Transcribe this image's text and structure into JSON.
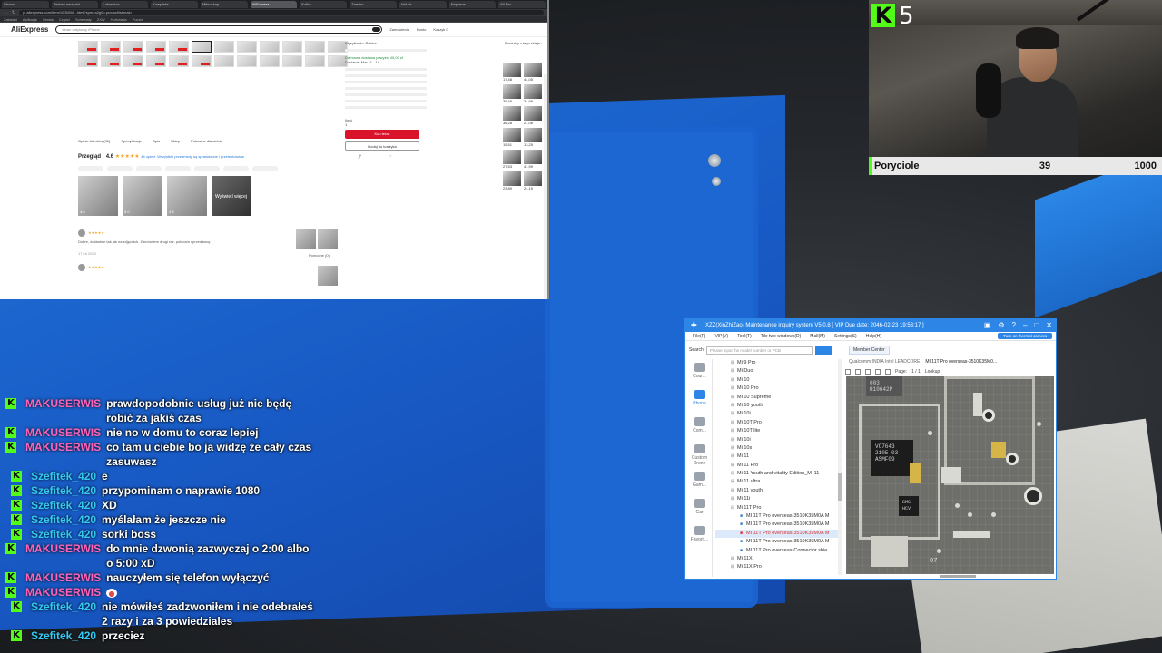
{
  "browser": {
    "tabs": [
      "Strona",
      "Zestaw narzędzi",
      "Lutownica",
      "Kompleks",
      "Mikroskop",
      "AliExpress",
      "Kolba",
      "Zamów",
      "Hot air",
      "Naprawa",
      "MI Pro"
    ],
    "address": "pl.aliexpress.com/item/1005006...html?spm=a2g0o.productlist.main",
    "bookmarks": [
      "Zakładki",
      "Aplikacje",
      "Serwis",
      "Części",
      "Schematy",
      "ZXW",
      "Hurtownia",
      "Poczta"
    ],
    "site_logo": "AliExpress",
    "search_placeholder": "ekran dotykowy iPhone",
    "header_right": [
      "Zamówienia",
      "Konto",
      "Koszyk 0"
    ],
    "detail_tabs": [
      "Opinie klientów (90)",
      "Specyfikacje",
      "Opis",
      "Sklep",
      "Polecane dla ciebie"
    ],
    "reviews_title": "Przegląd",
    "rating": "4.6",
    "stars": "★★★★★",
    "review_count": "44 opinie",
    "review_link": "Wszystkie przedmioty są sprawdzone i przetestowane",
    "photo_labels": [
      "4.6",
      "5.0",
      "4.8",
      "Wyświetl więcej"
    ],
    "review_text": "Dobre, dokładnie tak jak na zdjęciach. Zamówiłem drugi raz, polecam sprzedawcę.",
    "review_date": "17 lut 2024",
    "review_helpful": "Pomocne (0)",
    "buy": {
      "ship_to": "Wysyłka do: Polska",
      "delivery_note": "Darmowa dostawa powyżej 40,00 zł",
      "delivery_date": "Dostawa: Mar 11 - 14",
      "quantity_label": "Ilość",
      "quantity_value": "1",
      "buy_now": "Kup teraz",
      "add_to_cart": "Dodaj do koszyka"
    },
    "side_title": "Produkty z tego sklepu",
    "side_prices": [
      "17,48",
      "44,05",
      "35,49",
      "34,99",
      "36,28",
      "21,06",
      "15,51",
      "13,25",
      "27,53",
      "41,99",
      "23,89",
      "24,19"
    ]
  },
  "stream": {
    "k_count": "5",
    "goal_title": "Poryciole",
    "goal_value": "39",
    "goal_target": "1000"
  },
  "chat": [
    {
      "user": "MAKUSERWIS",
      "type": "mak",
      "text": "prawdopodobnie usług już nie będę robić za jakiś czas"
    },
    {
      "user": "MAKUSERWIS",
      "type": "mak",
      "text": "nie no w domu to coraz lepiej"
    },
    {
      "user": "MAKUSERWIS",
      "type": "mak",
      "text": "co tam u ciebie bo ja widzę że cały czas zasuwasz"
    },
    {
      "user": "Szefitek_420",
      "type": "szef",
      "text": "e"
    },
    {
      "user": "Szefitek_420",
      "type": "szef",
      "text": "przypominam o naprawie 1080"
    },
    {
      "user": "Szefitek_420",
      "type": "szef",
      "text": "XD"
    },
    {
      "user": "Szefitek_420",
      "type": "szef",
      "text": "myślałam że jeszcze nie"
    },
    {
      "user": "Szefitek_420",
      "type": "szef",
      "text": "sorki boss"
    },
    {
      "user": "MAKUSERWIS",
      "type": "mak",
      "text": "do mnie dzwonią zazwyczaj o 2:00 albo o 5:00 xD"
    },
    {
      "user": "MAKUSERWIS",
      "type": "mak",
      "text": "nauczyłem się telefon wyłączyć"
    },
    {
      "user": "MAKUSERWIS",
      "type": "mak",
      "text": ""
    },
    {
      "user": "Szefitek_420",
      "type": "szef",
      "text": "nie mówiłeś zadzwoniłem i nie odebrałeś 2 razy i za 3 powiedziales"
    },
    {
      "user": "Szefitek_420",
      "type": "szef",
      "text": "przeciez"
    }
  ],
  "zxw": {
    "title": "XZZ(XinZhiZao) Maintenance inquiry system V5.0.8 [ VIP Due date: 2046-02-23 19:53:17 ]",
    "menu": [
      "File(F)",
      "VIP(V)",
      "Tool(T)",
      "Tile two windows(D)",
      "Mall(M)",
      "Settings(S)",
      "Help(H)"
    ],
    "thermal_button": "Turn on thermal camera",
    "search_label": "Search",
    "search_placeholder": "Please input the model number or PCB",
    "member_center": "Member Center",
    "tabs": [
      "Qualcomm INDIA Intel LEADCORE",
      "MI 11T Pro overseas-3510K35M0..."
    ],
    "page_label": "Page:",
    "page_value": "1 / 1",
    "lookup": "Lookup",
    "nav": [
      "Cour...",
      "Phone",
      "Com...",
      "Custom Drone",
      "Gam...",
      "Car",
      "Favorit..."
    ],
    "tree": [
      {
        "label": "Mi 9 Pro",
        "kind": "folder"
      },
      {
        "label": "Mi Duo",
        "kind": "folder"
      },
      {
        "label": "Mi 10",
        "kind": "folder"
      },
      {
        "label": "Mi 10 Pro",
        "kind": "folder"
      },
      {
        "label": "Mi 10 Supreme",
        "kind": "folder"
      },
      {
        "label": "Mi 10 youth",
        "kind": "folder"
      },
      {
        "label": "Mi 10i",
        "kind": "folder"
      },
      {
        "label": "Mi 10T Pro",
        "kind": "folder"
      },
      {
        "label": "Mi 10T lite",
        "kind": "folder"
      },
      {
        "label": "Mi 10i",
        "kind": "folder"
      },
      {
        "label": "Mi 10s",
        "kind": "folder"
      },
      {
        "label": "Mi 11",
        "kind": "folder"
      },
      {
        "label": "Mi 11 Pro",
        "kind": "folder"
      },
      {
        "label": "Mi 11 Youth and vitality Edition_Mi 11",
        "kind": "folder"
      },
      {
        "label": "Mi 11 ultra",
        "kind": "folder"
      },
      {
        "label": "Mi 11 youth",
        "kind": "folder"
      },
      {
        "label": "Mi 11i",
        "kind": "folder"
      },
      {
        "label": "Mi 11T Pro",
        "kind": "open"
      },
      {
        "label": "MI 11T Pro overseas-3510K35M0A M",
        "kind": "child"
      },
      {
        "label": "MI 11T Pro overseas-3510K35M0A M",
        "kind": "child"
      },
      {
        "label": "MI 11T Pro overseas-3510K35M0A M",
        "kind": "selected"
      },
      {
        "label": "MI 11T Pro overseas-3510K35M0A M",
        "kind": "child"
      },
      {
        "label": "MI 11T Pro overseas-Connector shie",
        "kind": "child"
      },
      {
        "label": "Mi 11X",
        "kind": "folder"
      },
      {
        "label": "Mi 11X Pro",
        "kind": "folder"
      }
    ],
    "pcb_labels": {
      "chip1": "VC7643\n2105-03\nASMF09",
      "chip2": "003\nH10642P",
      "chip3": "SMG\nHCV",
      "num": "07"
    }
  },
  "colors": {
    "kick_green": "#53fc18",
    "mak_user": "#ff63b8",
    "szef_user": "#35c8f0",
    "zxw_blue": "#2d86e6",
    "ali_red": "#d9142a"
  }
}
